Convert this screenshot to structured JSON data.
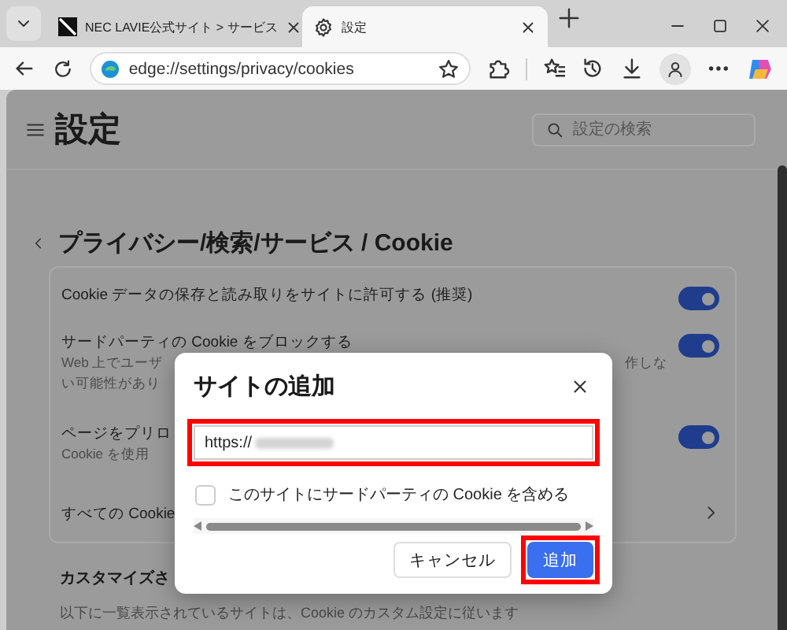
{
  "tabs": [
    {
      "title": "NEC LAVIE公式サイト > サービス",
      "kind": "site",
      "selected": false
    },
    {
      "title": "設定",
      "kind": "settings",
      "selected": true
    }
  ],
  "address_bar": {
    "url": "edge://settings/privacy/cookies"
  },
  "settings": {
    "title": "設定",
    "search": {
      "placeholder": "設定の検索"
    },
    "breadcrumb": "プライバシー/検索/サービス / Cookie",
    "rows": [
      {
        "kind": "toggle",
        "label": "Cookie データの保存と読み取りをサイトに許可する (推奨)",
        "on": true
      },
      {
        "kind": "toggle",
        "label": "サードパーティの Cookie をブロックする",
        "description": [
          "Web 上でユーザ",
          "い可能性があり"
        ],
        "description_right": "作しな",
        "on": true
      },
      {
        "kind": "toggle",
        "label": "ページをプリロ",
        "description": [
          "Cookie を使用"
        ],
        "on": true
      },
      {
        "kind": "link",
        "label": "すべての Cookie"
      }
    ],
    "section": {
      "title": "カスタマイズさ",
      "description": "以下に一覧表示されているサイトは、Cookie のカスタム設定に従います"
    }
  },
  "dialog": {
    "title": "サイトの追加",
    "url_field": {
      "value": "https://",
      "highlighted": true
    },
    "checkbox": {
      "label": "このサイトにサードパーティの Cookie を含める",
      "checked": false
    },
    "buttons": [
      {
        "label": "キャンセル",
        "kind": "secondary",
        "highlighted": false
      },
      {
        "label": "追加",
        "kind": "primary",
        "highlighted": true
      }
    ]
  }
}
